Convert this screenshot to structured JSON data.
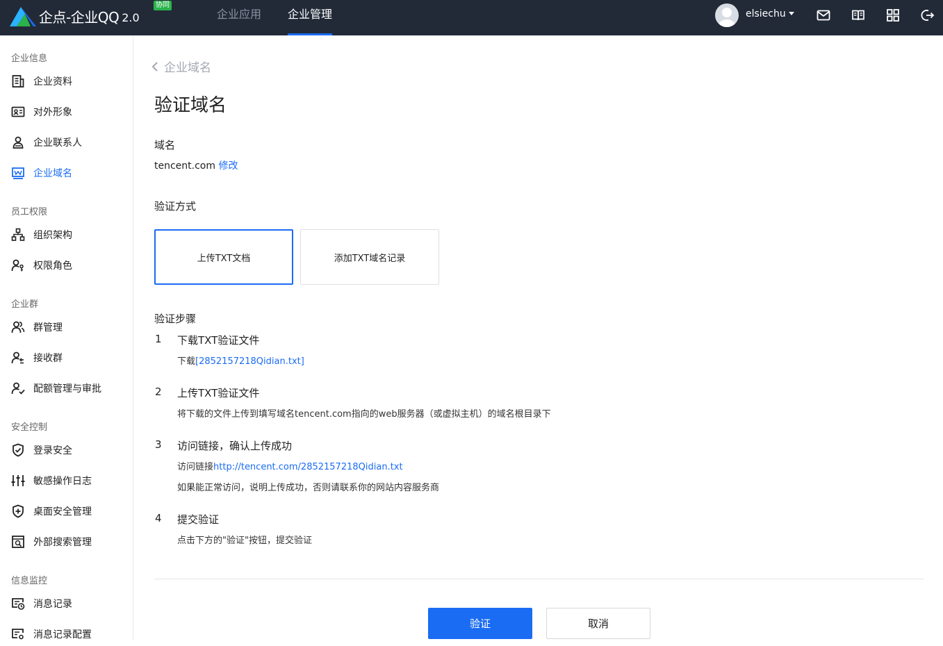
{
  "app": {
    "name": "企点-企业QQ",
    "version": "2.0",
    "badge": "协同",
    "brand_color": "#1a6cf3",
    "topbar_color": "#222a38"
  },
  "nav": {
    "tabs": [
      {
        "label": "企业应用",
        "active": false
      },
      {
        "label": "企业管理",
        "active": true
      }
    ]
  },
  "user": {
    "name": "elsiechu",
    "icons": [
      "mail-icon",
      "book-icon",
      "apps-grid-icon",
      "logout-icon"
    ]
  },
  "sidebar": {
    "groups": [
      {
        "title": "企业信息",
        "items": [
          {
            "label": "企业资料",
            "icon": "building-doc-icon"
          },
          {
            "label": "对外形象",
            "icon": "id-card-icon"
          },
          {
            "label": "企业联系人",
            "icon": "contact-person-icon"
          },
          {
            "label": "企业域名",
            "icon": "domain-icon",
            "active": true
          }
        ]
      },
      {
        "title": "员工权限",
        "items": [
          {
            "label": "组织架构",
            "icon": "org-chart-icon"
          },
          {
            "label": "权限角色",
            "icon": "role-key-icon"
          }
        ]
      },
      {
        "title": "企业群",
        "items": [
          {
            "label": "群管理",
            "icon": "group-icon"
          },
          {
            "label": "接收群",
            "icon": "receive-group-icon"
          },
          {
            "label": "配额管理与审批",
            "icon": "quota-approve-icon"
          }
        ]
      },
      {
        "title": "安全控制",
        "items": [
          {
            "label": "登录安全",
            "icon": "shield-check-icon"
          },
          {
            "label": "敏感操作日志",
            "icon": "sliders-icon"
          },
          {
            "label": "桌面安全管理",
            "icon": "shield-plus-icon"
          },
          {
            "label": "外部搜索管理",
            "icon": "search-box-icon"
          }
        ]
      },
      {
        "title": "信息监控",
        "items": [
          {
            "label": "消息记录",
            "icon": "message-history-icon"
          },
          {
            "label": "消息记录配置",
            "icon": "message-config-icon"
          }
        ]
      }
    ]
  },
  "main": {
    "back_label": "企业域名",
    "title": "验证域名",
    "domain_label": "域名",
    "domain_value": "tencent.com",
    "domain_edit": "修改",
    "method_label": "验证方式",
    "methods": [
      {
        "label": "上传TXT文档",
        "selected": true
      },
      {
        "label": "添加TXT域名记录",
        "selected": false
      }
    ],
    "steps_label": "验证步骤",
    "steps": [
      {
        "num": "1",
        "title": "下载TXT验证文件",
        "desc_prefix": "下载",
        "desc_link": "[2852157218Qidian.txt]"
      },
      {
        "num": "2",
        "title": "上传TXT验证文件",
        "desc": "将下载的文件上传到填写域名tencent.com指向的web服务器（或虚拟主机）的域名根目录下"
      },
      {
        "num": "3",
        "title": "访问链接，确认上传成功",
        "desc_prefix": "访问链接",
        "desc_link": "http://tencent.com/2852157218Qidian.txt",
        "desc2": "如果能正常访问，说明上传成功，否则请联系你的网站内容服务商"
      },
      {
        "num": "4",
        "title": "提交验证",
        "desc": "点击下方的\"验证\"按钮，提交验证"
      }
    ],
    "verify_button": "验证",
    "cancel_button": "取消"
  }
}
